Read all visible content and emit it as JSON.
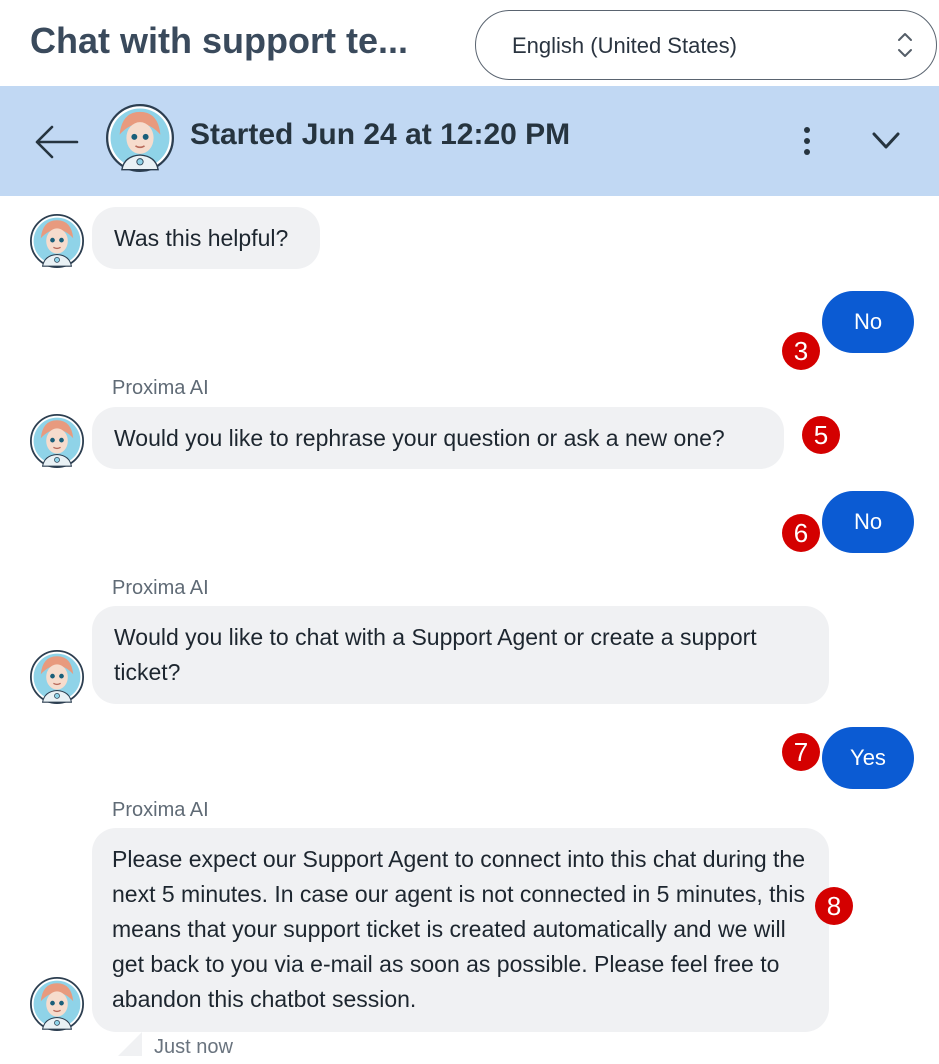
{
  "page": {
    "title": "Chat with support te..."
  },
  "language_select": {
    "value": "English (United States)"
  },
  "chat_header": {
    "title": "Started Jun 24 at 12:20 PM"
  },
  "messages": [
    {
      "from": "bot",
      "text": "Was this helpful?"
    },
    {
      "from": "user",
      "text": "No",
      "badge": "3"
    },
    {
      "from": "bot",
      "sender": "Proxima AI",
      "text": "Would you like to rephrase your question or ask a new one?",
      "badge": "5"
    },
    {
      "from": "user",
      "text": "No",
      "badge": "6"
    },
    {
      "from": "bot",
      "sender": "Proxima AI",
      "text": "Would you like to chat with a Support Agent or create a support ticket?"
    },
    {
      "from": "user",
      "text": "Yes",
      "badge": "7"
    },
    {
      "from": "bot",
      "sender": "Proxima AI",
      "text": "Please expect our Support Agent to connect into this chat during the next 5 minutes. In case our agent is not connected in 5 minutes, this means that your support ticket is created automatically and we will get back to you via e-mail as soon as possible. Please feel free to abandon this chatbot session.",
      "badge": "8",
      "timestamp": "Just now"
    }
  ],
  "icons": [
    "updown-icon",
    "back-arrow-icon",
    "kebab-icon",
    "chevron-down-icon",
    "bot-avatar"
  ],
  "colors": {
    "header_bg": "#c1d8f3",
    "user_bubble": "#0b5bd3",
    "bot_bubble": "#f0f1f3",
    "badge": "#d40000"
  }
}
